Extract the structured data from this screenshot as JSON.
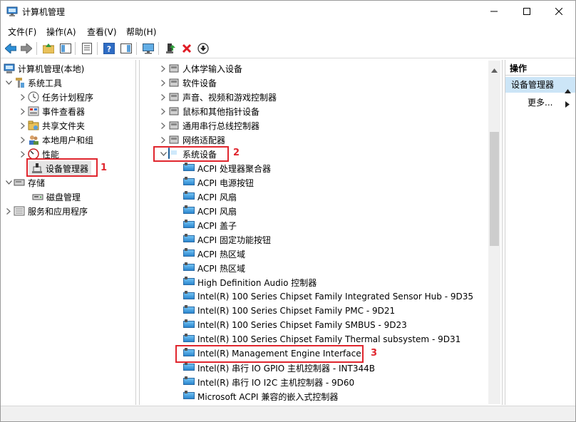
{
  "window": {
    "title": "计算机管理"
  },
  "menu": [
    "文件(F)",
    "操作(A)",
    "查看(V)",
    "帮助(H)"
  ],
  "left_tree": {
    "root": "计算机管理(本地)",
    "system_tools": "系统工具",
    "items": [
      "任务计划程序",
      "事件查看器",
      "共享文件夹",
      "本地用户和组",
      "性能",
      "设备管理器"
    ],
    "storage": "存储",
    "disk_mgmt": "磁盘管理",
    "services": "服务和应用程序"
  },
  "device_tree": {
    "collapsed": [
      "人体学输入设备",
      "软件设备",
      "声音、视频和游戏控制器",
      "鼠标和其他指针设备",
      "通用串行总线控制器",
      "网络适配器"
    ],
    "expanded_category": "系统设备",
    "devices": [
      "ACPI 处理器聚合器",
      "ACPI 电源按钮",
      "ACPI 风扇",
      "ACPI 风扇",
      "ACPI 盖子",
      "ACPI 固定功能按钮",
      "ACPI 热区域",
      "ACPI 热区域",
      "High Definition Audio 控制器",
      "Intel(R) 100 Series Chipset Family Integrated Sensor Hub - 9D35",
      "Intel(R) 100 Series Chipset Family PMC - 9D21",
      "Intel(R) 100 Series Chipset Family SMBUS - 9D23",
      "Intel(R) 100 Series Chipset Family Thermal subsystem - 9D31",
      "Intel(R) Management Engine Interface",
      "Intel(R) 串行 IO GPIO 主机控制器 - INT344B",
      "Intel(R) 串行 IO I2C 主机控制器 - 9D60",
      "Microsoft ACPI 兼容的嵌入式控制器"
    ]
  },
  "actions": {
    "header": "操作",
    "selected": "设备管理器",
    "more": "更多..."
  },
  "annotations": [
    "1",
    "2",
    "3"
  ],
  "colors": {
    "highlight": "#e0262e",
    "selection": "#cce5f7"
  }
}
